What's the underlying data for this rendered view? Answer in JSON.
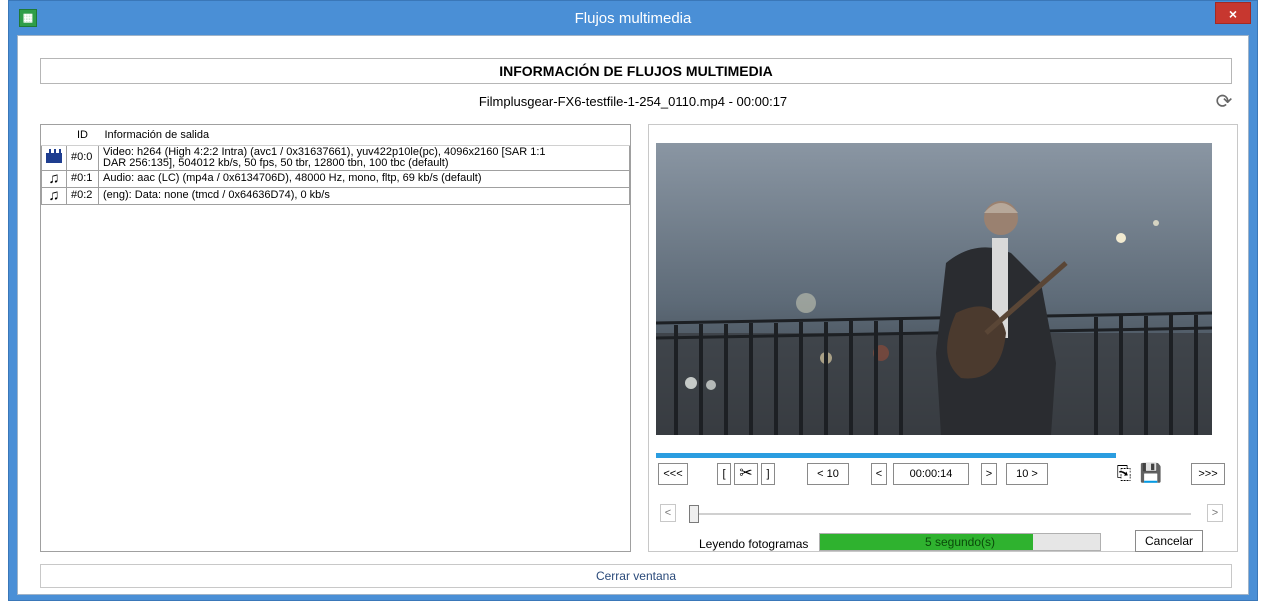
{
  "window": {
    "title": "Flujos multimedia",
    "close_symbol": "×",
    "app_icon": "app-icon",
    "accent": "#4a8fd6"
  },
  "header": {
    "title": "INFORMACIÓN DE FLUJOS MULTIMEDIA",
    "file_line": "Filmplusgear-FX6-testfile-1-254_0110.mp4 - 00:00:17"
  },
  "streams": {
    "columns": [
      "ID",
      "Información de salida"
    ],
    "rows": [
      {
        "icon": "video-icon",
        "id": "#0:0",
        "info_line1": "Video: h264 (High 4:2:2 Intra) (avc1 / 0x31637661), yuv422p10le(pc), 4096x2160 [SAR 1:1",
        "info_line2": "DAR 256:135], 504012 kb/s, 50 fps, 50 tbr, 12800 tbn, 100 tbc (default)"
      },
      {
        "icon": "audio-icon",
        "id": "#0:1",
        "info_line1": "Audio: aac (LC) (mp4a / 0x6134706D), 48000 Hz, mono, fltp, 69 kb/s (default)"
      },
      {
        "icon": "audio-icon",
        "id": "#0:2",
        "info_line1": "(eng): Data: none (tmcd / 0x64636D74), 0 kb/s"
      }
    ]
  },
  "player": {
    "btn_first": "<<<",
    "btn_mark_in": "[",
    "btn_mark_out": "]",
    "btn_back10": "< 10",
    "btn_back1": "<",
    "time": "00:00:14",
    "btn_fwd1": ">",
    "btn_fwd10": "10 >",
    "btn_last": ">>>",
    "scroll_left": "<",
    "scroll_right": ">",
    "reading_label": "Leyendo fotogramas",
    "reading_progress": 0.76,
    "reading_text": "5 segundo(s)",
    "cancel": "Cancelar"
  },
  "footer": {
    "close_window": "Cerrar ventana"
  }
}
